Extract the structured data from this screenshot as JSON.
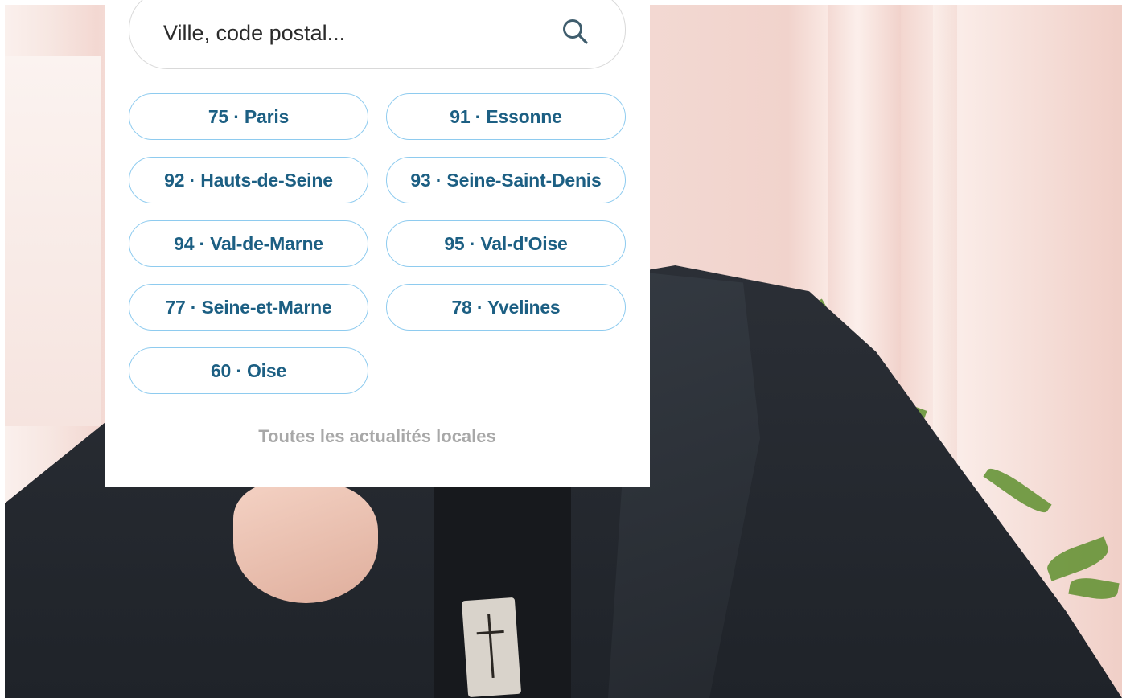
{
  "search": {
    "placeholder": "Ville, code postal...",
    "icon": "search-icon"
  },
  "departments": [
    {
      "label": "75 · Paris"
    },
    {
      "label": "91 · Essonne"
    },
    {
      "label": "92 · Hauts-de-Seine"
    },
    {
      "label": "93 · Seine-Saint-Denis"
    },
    {
      "label": "94 · Val-de-Marne"
    },
    {
      "label": "95 · Val-d'Oise"
    },
    {
      "label": "77 · Seine-et-Marne"
    },
    {
      "label": "78 · Yvelines"
    },
    {
      "label": "60 · Oise"
    }
  ],
  "footer_link": {
    "label": "Toutes les actualités locales"
  },
  "colors": {
    "button_text": "#1c5f83",
    "button_border": "#8ecbef",
    "link_gray": "#a8a8a8",
    "search_icon": "#3f5d6d"
  }
}
